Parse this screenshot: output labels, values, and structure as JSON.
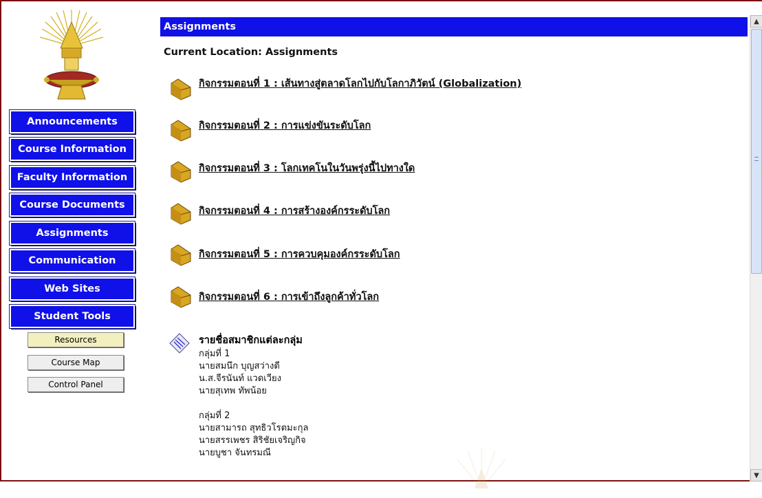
{
  "colors": {
    "nav_blue": "#1010e8",
    "frame_border": "#7a1010",
    "resources_bg": "#f3f0c0",
    "tool_bg": "#eeeeee"
  },
  "sidebar": {
    "logo_icon": "university-crest-icon",
    "nav_buttons": [
      "Announcements",
      "Course Information",
      "Faculty Information",
      "Course Documents",
      "Assignments",
      "Communication",
      "Web Sites",
      "Student Tools"
    ],
    "tool_buttons": [
      "Resources",
      "Course Map",
      "Control Panel"
    ]
  },
  "main": {
    "title": "Assignments",
    "location": "Current Location: Assignments",
    "folder_icon": "folder-icon",
    "items": [
      "กิจกรรมตอนที่ 1 : เส้นทางสู่ตลาดโลกไปกับโลกาภิวัตน์ (Globalization)",
      "กิจกรรมตอนที่ 2 : การแข่งขันระดับโลก",
      "กิจกรรมตอนที่ 3 : โลกเทคโนในวันพรุ่งนี้ไปทางใด",
      "กิจกรรมตอนที่ 4 : การสร้างองค์กรระดับโลก",
      "กิจกรรมตอนที่ 5 : การควบคุมองค์กรระดับโลก",
      "กิจกรรมตอนที่ 6 : การเข้าถึงลูกค้าทั่วโลก"
    ],
    "document": {
      "icon": "document-icon",
      "title": "รายชื่อสมาชิกแต่ละกลุ่ม",
      "lines": [
        "กลุ่มที่ 1",
        "นายสมนึก บุญสว่างดี",
        "น.ส.จีรนันท์ แวดเวียง",
        "นายสุเทพ ทัพน้อย",
        "",
        "กลุ่มที่ 2",
        "นายสามารถ สุทธิวโรตมะกุล",
        "นายสรรเพชร สิริชัยเจริญกิจ",
        "นายบูชา จันทรมณี"
      ]
    }
  }
}
